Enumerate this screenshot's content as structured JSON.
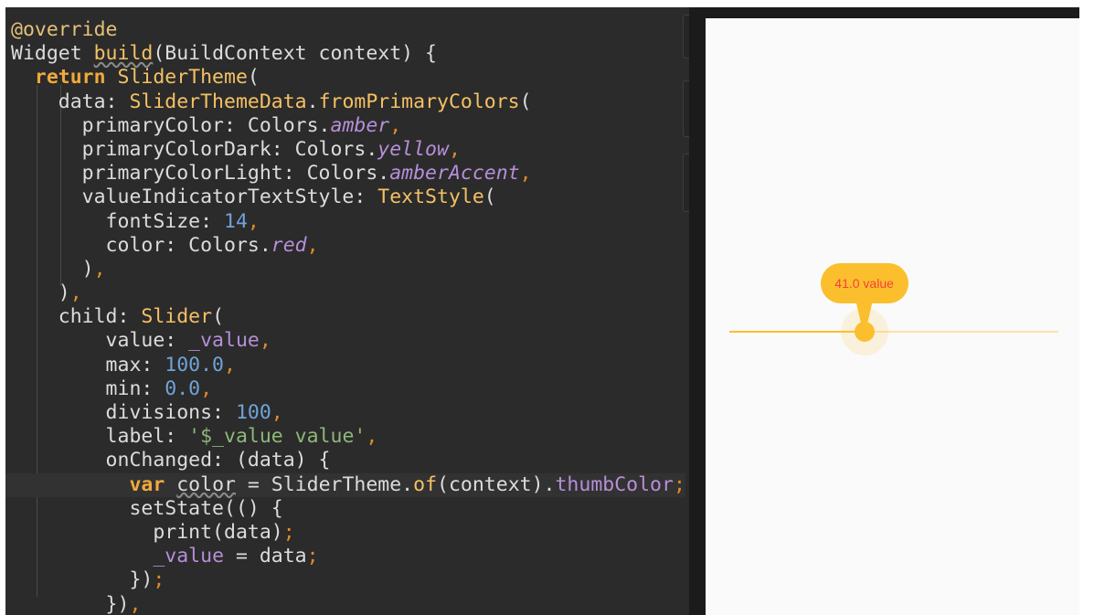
{
  "editor": {
    "lines": [
      [
        {
          "t": "@override",
          "c": "ann"
        }
      ],
      [
        {
          "t": "Widget ",
          "c": "pln"
        },
        {
          "t": "build",
          "c": "meth under"
        },
        {
          "t": "(BuildContext context) {",
          "c": "pln"
        }
      ],
      [
        {
          "t": "  ",
          "c": "pln"
        },
        {
          "t": "return ",
          "c": "kw"
        },
        {
          "t": "SliderTheme",
          "c": "cls"
        },
        {
          "t": "(",
          "c": "pln"
        }
      ],
      [
        {
          "t": "    data: ",
          "c": "pln"
        },
        {
          "t": "SliderThemeData",
          "c": "cls"
        },
        {
          "t": ".",
          "c": "pln"
        },
        {
          "t": "fromPrimaryColors",
          "c": "meth"
        },
        {
          "t": "(",
          "c": "pln"
        }
      ],
      [
        {
          "t": "      primaryColor: Colors.",
          "c": "pln"
        },
        {
          "t": "amber",
          "c": "prop"
        },
        {
          "t": ",",
          "c": "punc"
        }
      ],
      [
        {
          "t": "      primaryColorDark: Colors.",
          "c": "pln"
        },
        {
          "t": "yellow",
          "c": "prop"
        },
        {
          "t": ",",
          "c": "punc"
        }
      ],
      [
        {
          "t": "      primaryColorLight: Colors.",
          "c": "pln"
        },
        {
          "t": "amberAccent",
          "c": "prop"
        },
        {
          "t": ",",
          "c": "punc"
        }
      ],
      [
        {
          "t": "      valueIndicatorTextStyle: ",
          "c": "pln"
        },
        {
          "t": "TextStyle",
          "c": "cls"
        },
        {
          "t": "(",
          "c": "pln"
        }
      ],
      [
        {
          "t": "        fontSize: ",
          "c": "pln"
        },
        {
          "t": "14",
          "c": "num"
        },
        {
          "t": ",",
          "c": "punc"
        }
      ],
      [
        {
          "t": "        color: Colors.",
          "c": "pln"
        },
        {
          "t": "red",
          "c": "prop"
        },
        {
          "t": ",",
          "c": "punc"
        }
      ],
      [
        {
          "t": "      )",
          "c": "pln"
        },
        {
          "t": ",",
          "c": "punc"
        }
      ],
      [
        {
          "t": "    )",
          "c": "pln"
        },
        {
          "t": ",",
          "c": "punc"
        }
      ],
      [
        {
          "t": "    child: ",
          "c": "pln"
        },
        {
          "t": "Slider",
          "c": "cls"
        },
        {
          "t": "(",
          "c": "pln"
        }
      ],
      [
        {
          "t": "        value: ",
          "c": "pln"
        },
        {
          "t": "_value",
          "c": "fld"
        },
        {
          "t": ",",
          "c": "punc"
        }
      ],
      [
        {
          "t": "        max: ",
          "c": "pln"
        },
        {
          "t": "100.0",
          "c": "num"
        },
        {
          "t": ",",
          "c": "punc"
        }
      ],
      [
        {
          "t": "        min: ",
          "c": "pln"
        },
        {
          "t": "0.0",
          "c": "num"
        },
        {
          "t": ",",
          "c": "punc"
        }
      ],
      [
        {
          "t": "        divisions: ",
          "c": "pln"
        },
        {
          "t": "100",
          "c": "num"
        },
        {
          "t": ",",
          "c": "punc"
        }
      ],
      [
        {
          "t": "        label: ",
          "c": "pln"
        },
        {
          "t": "'$_value value'",
          "c": "str"
        },
        {
          "t": ",",
          "c": "punc"
        }
      ],
      [
        {
          "t": "        onChanged: (data) {",
          "c": "pln"
        }
      ],
      [
        {
          "t": "          ",
          "c": "pln"
        },
        {
          "t": "var ",
          "c": "kw"
        },
        {
          "t": "color",
          "c": "pln under"
        },
        {
          "t": " = SliderTheme.",
          "c": "pln"
        },
        {
          "t": "of",
          "c": "meth"
        },
        {
          "t": "(context).",
          "c": "pln"
        },
        {
          "t": "thumbColor",
          "c": "fld"
        },
        {
          "t": ";",
          "c": "punc"
        }
      ],
      [
        {
          "t": "          setState(() {",
          "c": "pln"
        }
      ],
      [
        {
          "t": "            print(data)",
          "c": "pln"
        },
        {
          "t": ";",
          "c": "punc"
        }
      ],
      [
        {
          "t": "            ",
          "c": "pln"
        },
        {
          "t": "_value",
          "c": "fld"
        },
        {
          "t": " = data",
          "c": "pln"
        },
        {
          "t": ";",
          "c": "punc"
        }
      ],
      [
        {
          "t": "          })",
          "c": "pln"
        },
        {
          "t": ";",
          "c": "punc"
        }
      ],
      [
        {
          "t": "        })",
          "c": "pln"
        },
        {
          "t": ",",
          "c": "punc"
        }
      ]
    ],
    "current_line": 19
  },
  "device": {
    "slider": {
      "value": 41.0,
      "min": 0.0,
      "max": 100.0,
      "label": "41.0 value",
      "active_color": "#fbbf2d",
      "inactive_color": "#fbe2a4",
      "label_text_color": "#f44336"
    }
  },
  "colors": {
    "editor_bg": "#2b2b2b",
    "device_bg": "#fafafa"
  }
}
